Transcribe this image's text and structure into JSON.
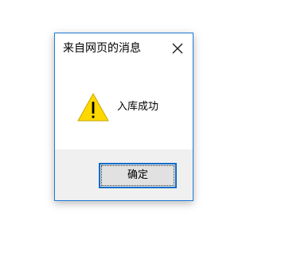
{
  "dialog": {
    "title": "来自网页的消息",
    "message": "入库成功",
    "ok_label": "确定",
    "close_icon": "close-icon",
    "message_icon": "warning-icon"
  },
  "colors": {
    "border": "#1f7ad6",
    "footer_bg": "#f0f0f0",
    "button_bg": "#e1e1e1",
    "button_border": "#0b6dc9",
    "warning_fill": "#ffd800"
  }
}
